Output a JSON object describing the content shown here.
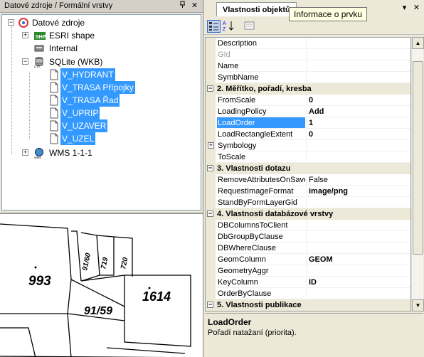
{
  "left_panel": {
    "title": "Datové zdroje / Formální vrstvy",
    "pin_glyph": "ᵖ",
    "close_glyph": "✕",
    "tree": {
      "root": "Datové zdroje",
      "items": [
        {
          "label": "ESRI shape",
          "icon": "shapefile-icon"
        },
        {
          "label": "Internal",
          "icon": "internal-db-icon"
        },
        {
          "label": "SQLite (WKB)",
          "icon": "sqlite-icon",
          "children": [
            {
              "label": "V_HYDRANT"
            },
            {
              "label": "V_TRASA Přípojky"
            },
            {
              "label": "V_TRASA Řad"
            },
            {
              "label": "V_UPRIP"
            },
            {
              "label": "V_UZAVER"
            },
            {
              "label": "V_UZEL"
            }
          ]
        },
        {
          "label": "WMS 1-1-1",
          "icon": "wms-globe-icon"
        }
      ]
    }
  },
  "map": {
    "parcels": [
      "993",
      "91/59",
      "1614",
      "91/60",
      "719",
      "720"
    ]
  },
  "right_panel": {
    "tab_label": "Vlastnosti objektů",
    "tooltip": "Informace o prvku",
    "pin_glyph": "▾",
    "close_glyph": "✕",
    "rows": [
      {
        "type": "prop",
        "name": "Description",
        "value": ""
      },
      {
        "type": "prop",
        "name": "GId",
        "value": "",
        "disabled": true
      },
      {
        "type": "prop",
        "name": "Name",
        "value": ""
      },
      {
        "type": "prop",
        "name": "SymbName",
        "value": ""
      },
      {
        "type": "cat",
        "label": "2. Měřítko, pořadí, kresba"
      },
      {
        "type": "prop",
        "name": "FromScale",
        "value": "0"
      },
      {
        "type": "prop",
        "name": "LoadingPolicy",
        "value": "Add"
      },
      {
        "type": "prop",
        "name": "LoadOrder",
        "value": "1",
        "selected": true
      },
      {
        "type": "prop",
        "name": "LoadRectangleExtent",
        "value": "0"
      },
      {
        "type": "prop",
        "name": "Symbology",
        "value": "",
        "expandable": true
      },
      {
        "type": "prop",
        "name": "ToScale",
        "value": ""
      },
      {
        "type": "cat",
        "label": "3. Vlastnosti dotazu"
      },
      {
        "type": "prop",
        "name": "RemoveAttributesOnSave",
        "value": "False",
        "normal": true
      },
      {
        "type": "prop",
        "name": "RequestImageFormat",
        "value": "image/png"
      },
      {
        "type": "prop",
        "name": "StandByFormLayerGid",
        "value": ""
      },
      {
        "type": "cat",
        "label": "4. Vlastnosti databázové vrstvy"
      },
      {
        "type": "prop",
        "name": "DBColumnsToClient",
        "value": ""
      },
      {
        "type": "prop",
        "name": "DbGroupByClause",
        "value": ""
      },
      {
        "type": "prop",
        "name": "DBWhereClause",
        "value": ""
      },
      {
        "type": "prop",
        "name": "GeomColumn",
        "value": "GEOM"
      },
      {
        "type": "prop",
        "name": "GeometryAggr",
        "value": ""
      },
      {
        "type": "prop",
        "name": "KeyColumn",
        "value": "ID"
      },
      {
        "type": "prop",
        "name": "OrderByClause",
        "value": ""
      },
      {
        "type": "cat",
        "label": "5. Vlastnosti publikace"
      }
    ],
    "description": {
      "title": "LoadOrder",
      "text": "Pořadí natažaní (priorita)."
    }
  },
  "colors": {
    "selection": "#3399ff",
    "panel": "#ece9d8",
    "tooltip_bg": "#ffffe1"
  }
}
